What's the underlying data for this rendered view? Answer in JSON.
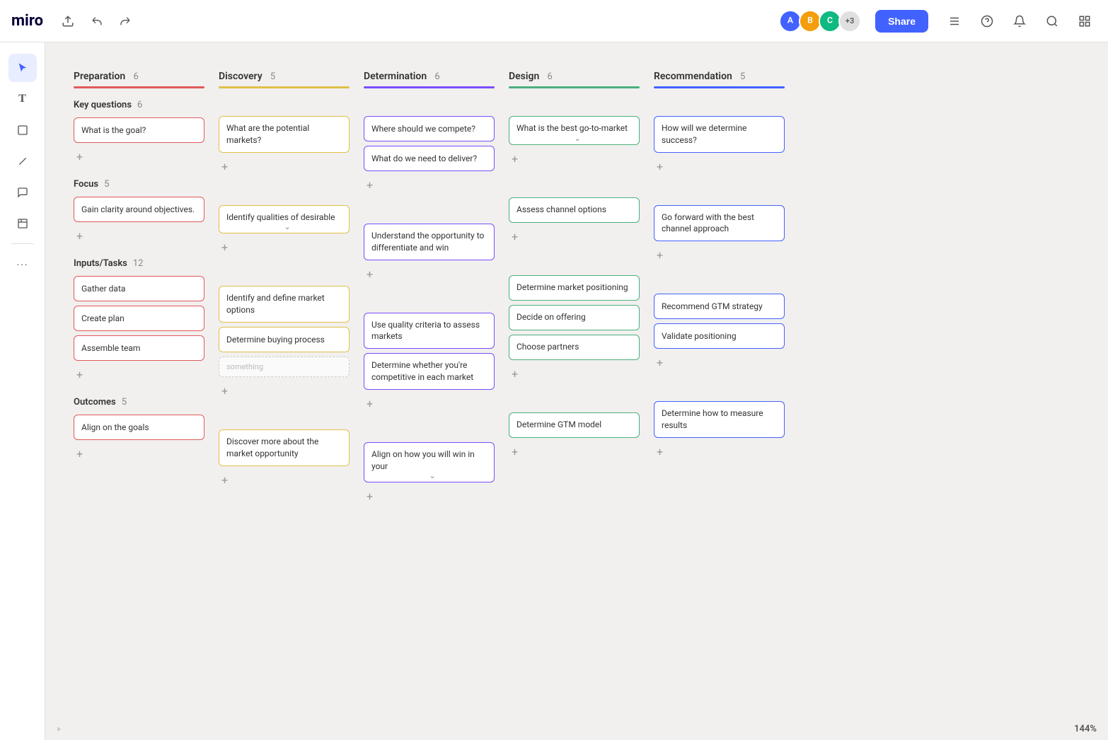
{
  "app": {
    "name": "miro"
  },
  "header": {
    "share_label": "Share",
    "zoom_label": "144%"
  },
  "columns": [
    {
      "id": "preparation",
      "title": "Preparation",
      "count": 6,
      "color_class": "line-red",
      "sections": [
        {
          "id": "key-questions",
          "title": "Key questions",
          "count": 6,
          "cards": [
            {
              "text": "What is the goal?",
              "color": "card-red"
            }
          ]
        },
        {
          "id": "focus",
          "title": "Focus",
          "count": 5,
          "cards": [
            {
              "text": "Gain clarity around objectives.",
              "color": "card-red"
            }
          ]
        },
        {
          "id": "inputs-tasks",
          "title": "Inputs/Tasks",
          "count": 12,
          "cards": [
            {
              "text": "Gather data",
              "color": "card-red"
            },
            {
              "text": "Create plan",
              "color": "card-red"
            },
            {
              "text": "Assemble team",
              "color": "card-red"
            }
          ]
        },
        {
          "id": "outcomes",
          "title": "Outcomes",
          "count": 5,
          "cards": [
            {
              "text": "Align on the goals",
              "color": "card-red"
            }
          ]
        }
      ]
    },
    {
      "id": "discovery",
      "title": "Discovery",
      "count": 5,
      "color_class": "line-yellow",
      "sections": [
        {
          "id": "key-questions",
          "title": "",
          "count": 0,
          "cards": [
            {
              "text": "What are the potential markets?",
              "color": "card-yellow"
            }
          ]
        },
        {
          "id": "focus",
          "title": "",
          "count": 0,
          "cards": [
            {
              "text": "Identify qualities of desirable",
              "color": "card-yellow",
              "expand": true
            }
          ]
        },
        {
          "id": "inputs-tasks",
          "title": "",
          "count": 0,
          "cards": [
            {
              "text": "Identify and define market options",
              "color": "card-yellow"
            },
            {
              "text": "Determine buying process",
              "color": "card-yellow"
            }
          ]
        },
        {
          "id": "outcomes",
          "title": "",
          "count": 0,
          "cards": [
            {
              "text": "Discover more about the market opportunity",
              "color": "card-yellow"
            }
          ]
        }
      ]
    },
    {
      "id": "determination",
      "title": "Determination",
      "count": 6,
      "color_class": "line-purple",
      "sections": [
        {
          "id": "key-questions",
          "title": "",
          "count": 0,
          "cards": [
            {
              "text": "Where should we compete?",
              "color": "card-purple"
            },
            {
              "text": "What do we need to deliver?",
              "color": "card-purple"
            }
          ]
        },
        {
          "id": "focus",
          "title": "",
          "count": 0,
          "cards": [
            {
              "text": "Understand the opportunity to differentiate and win",
              "color": "card-purple"
            }
          ]
        },
        {
          "id": "inputs-tasks",
          "title": "",
          "count": 0,
          "cards": [
            {
              "text": "Use quality criteria to assess markets",
              "color": "card-purple"
            },
            {
              "text": "Determine whether you're competitive in each market",
              "color": "card-purple"
            }
          ]
        },
        {
          "id": "outcomes",
          "title": "",
          "count": 0,
          "cards": [
            {
              "text": "Align on how you will win in your",
              "color": "card-purple",
              "expand": true
            }
          ]
        }
      ]
    },
    {
      "id": "design",
      "title": "Design",
      "count": 6,
      "color_class": "line-green",
      "sections": [
        {
          "id": "key-questions",
          "title": "",
          "count": 0,
          "cards": [
            {
              "text": "What is the best go-to-market",
              "color": "card-green",
              "expand": true
            }
          ]
        },
        {
          "id": "focus",
          "title": "",
          "count": 0,
          "cards": [
            {
              "text": "Assess channel options",
              "color": "card-green"
            }
          ]
        },
        {
          "id": "inputs-tasks",
          "title": "",
          "count": 0,
          "cards": [
            {
              "text": "Determine market positioning",
              "color": "card-green"
            },
            {
              "text": "Decide on offering",
              "color": "card-green"
            },
            {
              "text": "Choose partners",
              "color": "card-green"
            }
          ]
        },
        {
          "id": "outcomes",
          "title": "",
          "count": 0,
          "cards": [
            {
              "text": "Determine GTM model",
              "color": "card-green"
            }
          ]
        }
      ]
    },
    {
      "id": "recommendation",
      "title": "Recommendation",
      "count": 5,
      "color_class": "line-blue",
      "sections": [
        {
          "id": "key-questions",
          "title": "",
          "count": 0,
          "cards": [
            {
              "text": "How will we determine success?",
              "color": "card-blue"
            }
          ]
        },
        {
          "id": "focus",
          "title": "",
          "count": 0,
          "cards": [
            {
              "text": "Go forward with the best channel approach",
              "color": "card-blue"
            }
          ]
        },
        {
          "id": "inputs-tasks",
          "title": "",
          "count": 0,
          "cards": [
            {
              "text": "Recommend GTM strategy",
              "color": "card-blue"
            },
            {
              "text": "Validate positioning",
              "color": "card-blue"
            }
          ]
        },
        {
          "id": "outcomes",
          "title": "",
          "count": 0,
          "cards": [
            {
              "text": "Determine how to measure results",
              "color": "card-blue"
            }
          ]
        }
      ]
    }
  ],
  "toolbar": {
    "tools": [
      {
        "id": "cursor",
        "icon": "↖",
        "label": "cursor-tool"
      },
      {
        "id": "text",
        "icon": "T",
        "label": "text-tool"
      },
      {
        "id": "sticky",
        "icon": "⬜",
        "label": "sticky-tool"
      },
      {
        "id": "line",
        "icon": "╱",
        "label": "line-tool"
      },
      {
        "id": "comment",
        "icon": "💬",
        "label": "comment-tool"
      },
      {
        "id": "frame",
        "icon": "⬛",
        "label": "frame-tool"
      },
      {
        "id": "more",
        "icon": "···",
        "label": "more-tools"
      }
    ]
  },
  "sections_labels": {
    "key_questions": "Key questions",
    "focus": "Focus",
    "inputs_tasks": "Inputs/Tasks",
    "outcomes": "Outcomes"
  },
  "ghost_card_text": "something"
}
